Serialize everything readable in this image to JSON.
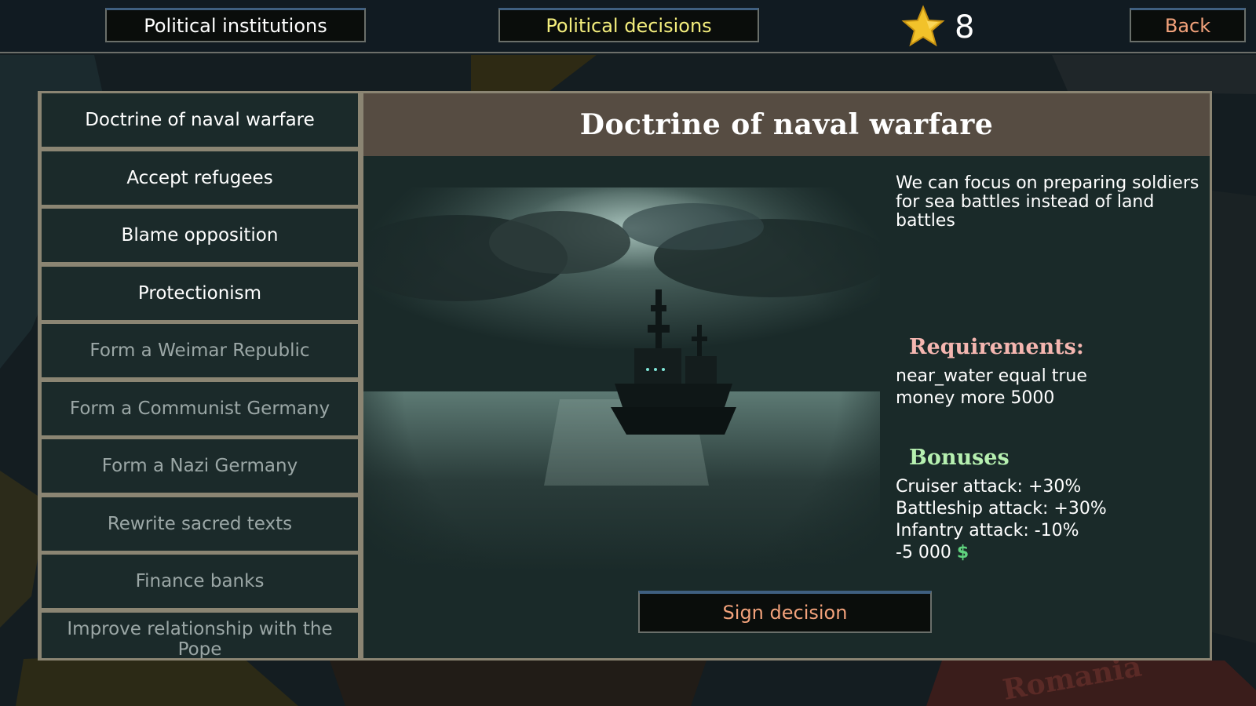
{
  "topbar": {
    "institutions_label": "Political institutions",
    "decisions_label": "Political decisions",
    "points": "8",
    "points_icon": "star-icon",
    "back_label": "Back"
  },
  "background_map": {
    "visible_label": "Romania"
  },
  "decision_list": [
    {
      "label": "Doctrine of naval warfare",
      "state": "active"
    },
    {
      "label": "Accept refugees",
      "state": "active"
    },
    {
      "label": "Blame opposition",
      "state": "active"
    },
    {
      "label": "Protectionism",
      "state": "active"
    },
    {
      "label": "Form a Weimar Republic",
      "state": "unavailable"
    },
    {
      "label": "Form a Communist Germany",
      "state": "unavailable"
    },
    {
      "label": "Form a Nazi Germany",
      "state": "unavailable"
    },
    {
      "label": "Rewrite sacred texts",
      "state": "unavailable"
    },
    {
      "label": "Finance banks",
      "state": "unavailable"
    },
    {
      "label": "Improve relationship with the Pope",
      "state": "unavailable"
    }
  ],
  "detail": {
    "title": "Doctrine of naval warfare",
    "description": "We can focus on preparing soldiers for sea battles instead of land battles",
    "requirements_title": "Requirements:",
    "requirements": [
      "near_water equal true",
      "money more 5000"
    ],
    "bonuses_title": "Bonuses",
    "bonuses": [
      "Cruiser attack: +30%",
      "Battleship attack: +30%",
      "Infantry attack: -10%"
    ],
    "cost": "-5 000",
    "cost_icon": "$",
    "sign_label": "Sign decision"
  },
  "colors": {
    "active_text": "#ffffff",
    "unavailable_text": "#9ba7a6",
    "requirements_title": "#f4b6b0",
    "bonuses_title": "#b6f0b0",
    "accent_orange": "#f2a27b",
    "accent_yellow": "#f4ee7d",
    "money_green": "#5fd37e"
  }
}
